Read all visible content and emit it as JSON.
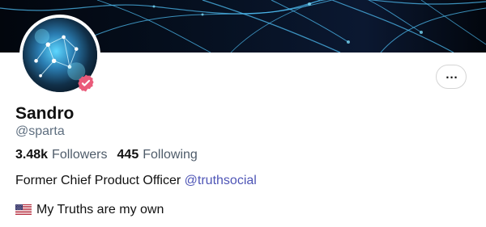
{
  "profile": {
    "display_name": "Sandro",
    "handle": "@sparta",
    "followers_count": "3.48k",
    "followers_label": "Followers",
    "following_count": "445",
    "following_label": "Following",
    "bio_prefix": "Former Chief Product Officer ",
    "bio_link": "@truthsocial",
    "bio_line_2": "My Truths are my own"
  },
  "icons": {
    "verified": "verified-badge-icon",
    "menu": "more-options-icon",
    "flag": "us-flag-icon"
  },
  "colors": {
    "verified": "#ea5b7a",
    "link": "#4e55b6",
    "muted_text": "#5f6f80",
    "border": "#d5d5d5",
    "banner": "#040913"
  }
}
